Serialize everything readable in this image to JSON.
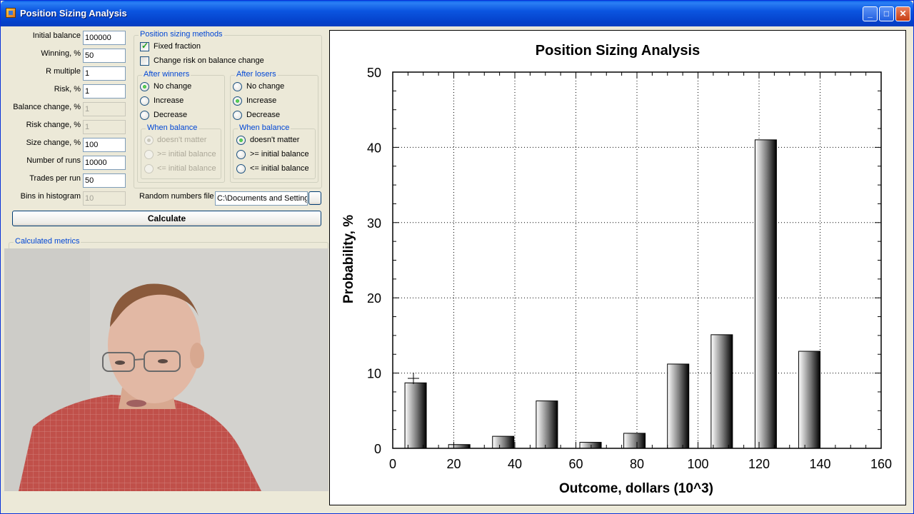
{
  "window": {
    "title": "Position Sizing Analysis",
    "buttons": {
      "minimize": "_",
      "maximize": "□",
      "close": "✕"
    }
  },
  "form": {
    "fields": [
      {
        "label": "Initial balance",
        "value": "100000",
        "enabled": true
      },
      {
        "label": "Winning, %",
        "value": "50",
        "enabled": true
      },
      {
        "label": "R multiple",
        "value": "1",
        "enabled": true
      },
      {
        "label": "Risk, %",
        "value": "1",
        "enabled": true
      },
      {
        "label": "Balance change, %",
        "value": "1",
        "enabled": false
      },
      {
        "label": "Risk change, %",
        "value": "1",
        "enabled": false
      },
      {
        "label": "Size change, %",
        "value": "100",
        "enabled": true
      },
      {
        "label": "Number of runs",
        "value": "10000",
        "enabled": true
      },
      {
        "label": "Trades per run",
        "value": "50",
        "enabled": true
      },
      {
        "label": "Bins in histogram",
        "value": "10",
        "enabled": false
      }
    ],
    "position_sizing": {
      "title": "Position sizing methods",
      "fixed_fraction": "Fixed fraction",
      "change_risk": "Change risk on balance change",
      "after_winners": {
        "title": "After winners",
        "options": [
          "No change",
          "Increase",
          "Decrease"
        ],
        "selected": 0,
        "when_balance": {
          "title": "When balance",
          "options": [
            "doesn't matter",
            ">= initial balance",
            "<= initial balance"
          ],
          "selected": 0,
          "enabled": false
        }
      },
      "after_losers": {
        "title": "After losers",
        "options": [
          "No change",
          "Increase",
          "Decrease"
        ],
        "selected": 1,
        "when_balance": {
          "title": "When balance",
          "options": [
            "doesn't matter",
            ">= initial balance",
            "<= initial balance"
          ],
          "selected": 0,
          "enabled": true
        }
      }
    },
    "random_numbers_file": {
      "label": "Random numbers file",
      "value": "C:\\Documents and Settings"
    },
    "calculate_label": "Calculate",
    "metrics_title": "Calculated metrics"
  },
  "chart_data": {
    "type": "bar",
    "title": "Position Sizing Analysis",
    "xlabel": "Outcome, dollars (10^3)",
    "ylabel": "Probability, %",
    "xlim": [
      0,
      160
    ],
    "ylim": [
      0,
      50
    ],
    "xticks": [
      0,
      20,
      40,
      60,
      80,
      100,
      120,
      140,
      160
    ],
    "yticks": [
      0,
      10,
      20,
      30,
      40,
      50
    ],
    "grid": true,
    "bars": [
      {
        "x": 7.5,
        "value": 8.7
      },
      {
        "x": 21.8,
        "value": 0.5
      },
      {
        "x": 36.2,
        "value": 1.6
      },
      {
        "x": 50.5,
        "value": 6.3
      },
      {
        "x": 64.8,
        "value": 0.8
      },
      {
        "x": 79.2,
        "value": 2.0
      },
      {
        "x": 93.5,
        "value": 11.2
      },
      {
        "x": 107.8,
        "value": 15.1
      },
      {
        "x": 122.2,
        "value": 41.0
      },
      {
        "x": 136.5,
        "value": 12.9
      }
    ]
  },
  "colors": {
    "titlebar": "#0a52d8",
    "group_title": "#0046d5",
    "window_bg": "#ece9d8"
  }
}
